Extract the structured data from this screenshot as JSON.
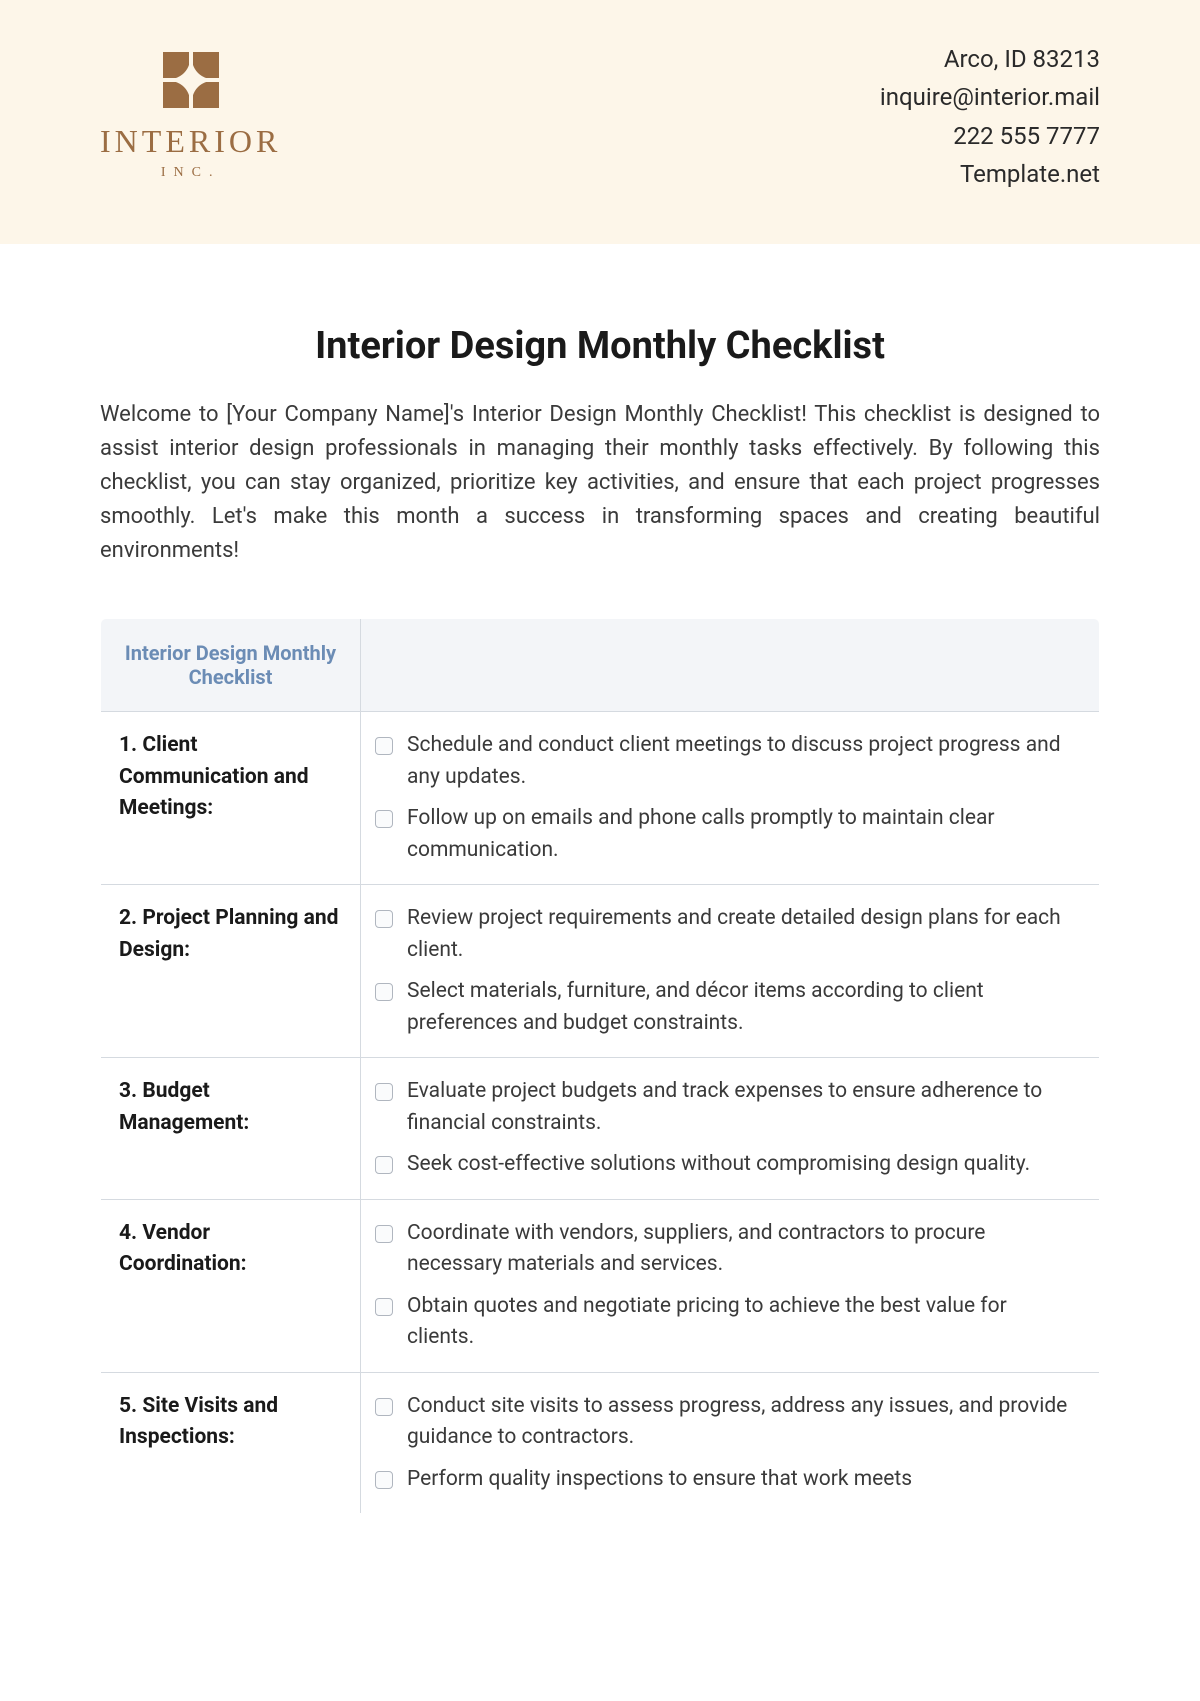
{
  "header": {
    "company_name": "INTERIOR",
    "company_suffix": "INC.",
    "contact": {
      "address": "Arco, ID 83213",
      "email": "inquire@interior.mail",
      "phone": "222 555 7777",
      "website": "Template.net"
    }
  },
  "title": "Interior Design Monthly Checklist",
  "intro": "Welcome to [Your Company Name]'s Interior Design Monthly Checklist! This checklist is designed to assist interior design professionals in managing their monthly tasks effectively. By following this checklist, you can stay organized, prioritize key activities, and ensure that each project progresses smoothly. Let's make this month a success in transforming spaces and creating beautiful environments!",
  "table": {
    "header_left": "Interior Design Monthly Checklist",
    "categories": [
      {
        "label": "1. Client Communication and Meetings:",
        "tasks": [
          "Schedule and conduct client meetings to discuss project progress and any updates.",
          "Follow up on emails and phone calls promptly to maintain clear communication."
        ]
      },
      {
        "label": "2. Project Planning and Design:",
        "tasks": [
          "Review project requirements and create detailed design plans for each client.",
          "Select materials, furniture, and décor items according to client preferences and budget constraints."
        ]
      },
      {
        "label": "3. Budget Management:",
        "tasks": [
          "Evaluate project budgets and track expenses to ensure adherence to financial constraints.",
          "Seek cost-effective solutions without compromising design quality."
        ]
      },
      {
        "label": "4. Vendor Coordination:",
        "tasks": [
          "Coordinate with vendors, suppliers, and contractors to procure necessary materials and services.",
          "Obtain quotes and negotiate pricing to achieve the best value for clients."
        ]
      },
      {
        "label": "5. Site Visits and Inspections:",
        "tasks": [
          "Conduct site visits to assess progress, address any issues, and provide guidance to contractors.",
          "Perform quality inspections to ensure that work meets"
        ]
      }
    ]
  }
}
